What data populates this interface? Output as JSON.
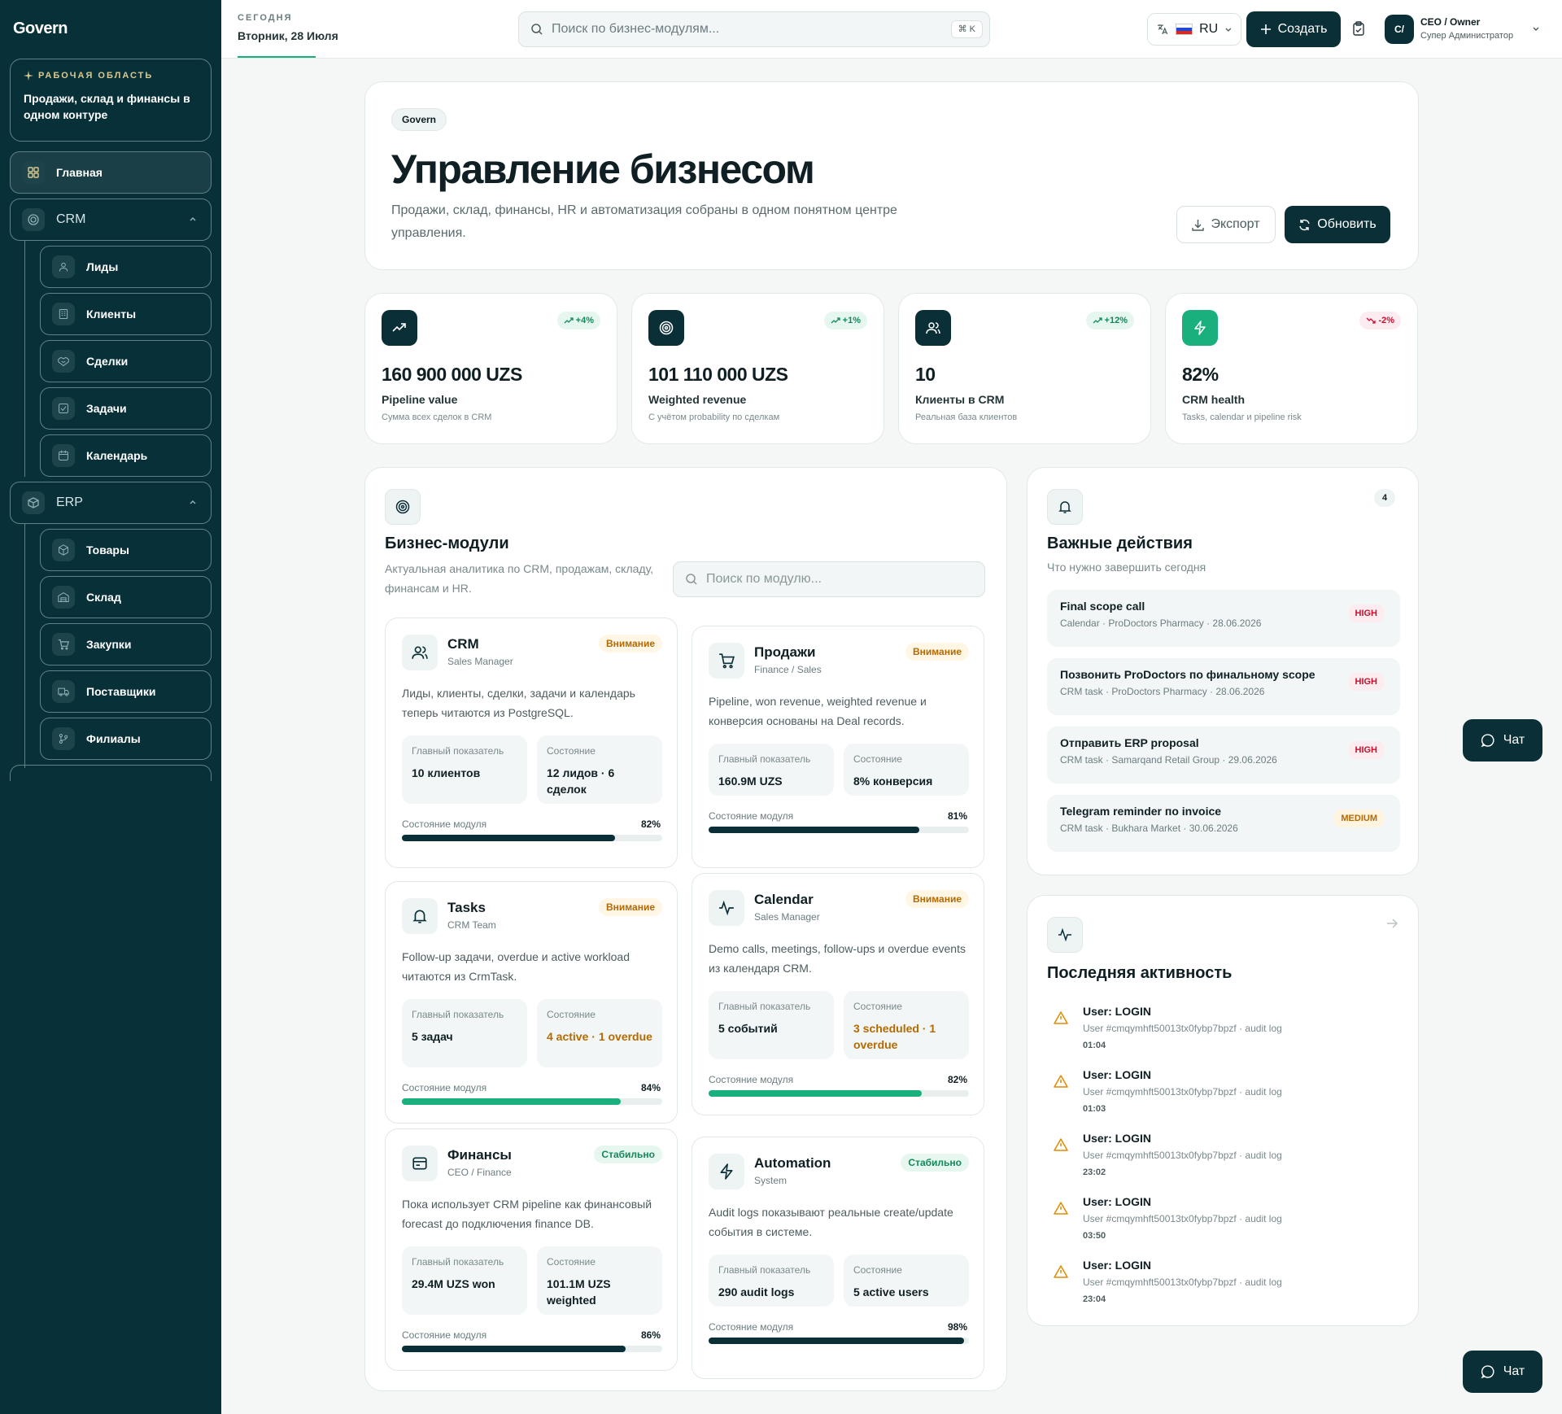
{
  "sidebar": {
    "brand": "Govern",
    "workspace_label": "РАБОЧАЯ ОБЛАСТЬ",
    "workspace_text": "Продажи, склад и финансы в одном контуре",
    "home": "Главная",
    "crm": "CRM",
    "crm_items": [
      "Лиды",
      "Клиенты",
      "Сделки",
      "Задачи",
      "Календарь"
    ],
    "erp": "ERP",
    "erp_items": [
      "Товары",
      "Склад",
      "Закупки",
      "Поставщики",
      "Филиалы"
    ]
  },
  "header": {
    "today_label": "СЕГОДНЯ",
    "today_value": "Вторник, 28 Июля",
    "search_placeholder": "Поиск по бизнес-модулям...",
    "search_shortcut": "⌘ K",
    "language": "RU",
    "create": "Создать",
    "user_initials": "C/",
    "user_name": "CEO / Owner",
    "user_role": "Супер Администратор"
  },
  "hero": {
    "badge": "Govern",
    "title": "Управление бизнесом",
    "subtitle": "Продажи, склад, финансы, HR и автоматизация собраны в одном понятном центре управления.",
    "export": "Экспорт",
    "refresh": "Обновить"
  },
  "stats": [
    {
      "value": "160 900 000 UZS",
      "name": "Pipeline value",
      "desc": "Сумма всех сделок в CRM",
      "change": "+4%",
      "trend": "up",
      "icon": "trending-up-icon"
    },
    {
      "value": "101 110 000 UZS",
      "name": "Weighted revenue",
      "desc": "С учётом probability по сделкам",
      "change": "+1%",
      "trend": "up",
      "icon": "target-icon"
    },
    {
      "value": "10",
      "name": "Клиенты в CRM",
      "desc": "Реальная база клиентов",
      "change": "+12%",
      "trend": "up",
      "icon": "users-icon"
    },
    {
      "value": "82%",
      "name": "CRM health",
      "desc": "Tasks, calendar и pipeline risk",
      "change": "-2%",
      "trend": "down",
      "icon": "bolt-icon"
    }
  ],
  "modules_section": {
    "title": "Бизнес-модули",
    "subtitle": "Актуальная аналитика по CRM, продажам, складу, финансам и HR.",
    "search_placeholder": "Поиск по модулю..."
  },
  "modules_labels": {
    "main": "Главный показатель",
    "state": "Состояние",
    "health": "Состояние модуля"
  },
  "modules": [
    {
      "title": "CRM",
      "role": "Sales Manager",
      "badge": "Внимание",
      "status": "warn",
      "desc": "Лиды, клиенты, сделки, задачи и календарь теперь читаются из PostgreSQL.",
      "main_value": "10 клиентов",
      "state_value": "12 лидов · 6 сделок",
      "progress": 82,
      "progress_label": "82%",
      "bar": "dark",
      "icon": "users-icon"
    },
    {
      "title": "Продажи",
      "role": "Finance / Sales",
      "badge": "Внимание",
      "status": "warn",
      "desc": "Pipeline, won revenue, weighted revenue и конверсия основаны на Deal records.",
      "main_value": "160.9M UZS",
      "state_value": "8% конверсия",
      "progress": 81,
      "progress_label": "81%",
      "bar": "dark",
      "icon": "cart-icon"
    },
    {
      "title": "Tasks",
      "role": "CRM Team",
      "badge": "Внимание",
      "status": "warn",
      "desc": "Follow-up задачи, overdue и active workload читаются из CrmTask.",
      "main_value": "5 задач",
      "state_value": "4 active · 1 overdue",
      "progress": 84,
      "progress_label": "84%",
      "bar": "green",
      "icon": "bell-icon"
    },
    {
      "title": "Calendar",
      "role": "Sales Manager",
      "badge": "Внимание",
      "status": "warn",
      "desc": "Demo calls, meetings, follow-ups и overdue events из календаря CRM.",
      "main_value": "5 событий",
      "state_value": "3 scheduled · 1 overdue",
      "progress": 82,
      "progress_label": "82%",
      "bar": "green",
      "icon": "activity-icon"
    },
    {
      "title": "Финансы",
      "role": "CEO / Finance",
      "badge": "Стабильно",
      "status": "ok",
      "desc": "Пока использует CRM pipeline как финансовый forecast до подключения finance DB.",
      "main_value": "29.4M UZS won",
      "state_value": "101.1M UZS weighted",
      "progress": 86,
      "progress_label": "86%",
      "bar": "dark",
      "icon": "wallet-icon"
    },
    {
      "title": "Automation",
      "role": "System",
      "badge": "Стабильно",
      "status": "ok",
      "desc": "Audit logs показывают реальные create/update события в системе.",
      "main_value": "290 audit logs",
      "state_value": "5 active users",
      "progress": 98,
      "progress_label": "98%",
      "bar": "dark",
      "icon": "bolt-icon"
    }
  ],
  "actions": {
    "title": "Важные действия",
    "subtitle": "Что нужно завершить сегодня",
    "count": "4",
    "items": [
      {
        "title": "Final scope call",
        "meta": "Calendar · ProDoctors Pharmacy · 28.06.2026",
        "priority": "HIGH"
      },
      {
        "title": "Позвонить ProDoctors по финальному scope",
        "meta": "CRM task · ProDoctors Pharmacy · 28.06.2026",
        "priority": "HIGH"
      },
      {
        "title": "Отправить ERP proposal",
        "meta": "CRM task · Samarqand Retail Group · 29.06.2026",
        "priority": "HIGH"
      },
      {
        "title": "Telegram reminder по invoice",
        "meta": "CRM task · Bukhara Market · 30.06.2026",
        "priority": "MEDIUM"
      }
    ]
  },
  "activity": {
    "title": "Последняя активность",
    "items": [
      {
        "title": "User: LOGIN",
        "meta": "User #cmqymhft50013tx0fybp7bpzf · audit log",
        "time": "01:04"
      },
      {
        "title": "User: LOGIN",
        "meta": "User #cmqymhft50013tx0fybp7bpzf · audit log",
        "time": "01:03"
      },
      {
        "title": "User: LOGIN",
        "meta": "User #cmqymhft50013tx0fybp7bpzf · audit log",
        "time": "23:02"
      },
      {
        "title": "User: LOGIN",
        "meta": "User #cmqymhft50013tx0fybp7bpzf · audit log",
        "time": "03:50"
      },
      {
        "title": "User: LOGIN",
        "meta": "User #cmqymhft50013tx0fybp7bpzf · audit log",
        "time": "23:04"
      }
    ]
  },
  "chat_label": "Чат",
  "colors": {
    "sidebar": "#083039",
    "primary": "#0b2f37",
    "green": "#19b07e",
    "warn": "#b56a00",
    "danger": "#c8102e"
  }
}
